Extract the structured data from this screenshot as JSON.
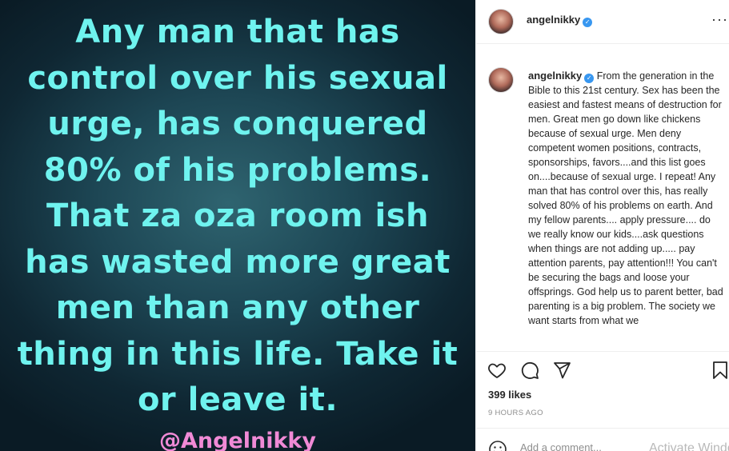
{
  "post": {
    "quote_lines": [
      "Any man that has",
      "control over his sexual",
      "urge, has conquered",
      "80% of his problems.",
      "That za oza room ish",
      "has wasted more great",
      "men than any other",
      "thing in this life. Take it",
      "or leave it."
    ],
    "watermark_handle": "@Angelnikky"
  },
  "header": {
    "username": "angelnikky",
    "verified_glyph": "✓",
    "more_label": "···"
  },
  "caption": {
    "username": "angelnikky",
    "verified_glyph": "✓",
    "text": "From the generation in the Bible to this 21st century. Sex has been the easiest and fastest means of destruction for men. Great men go down like chickens because of sexual urge. Men deny competent women positions, contracts, sponsorships, favors....and this list goes on....because of sexual urge. I repeat! Any man that has control over this, has really solved 80% of his problems on earth. And my fellow parents.... apply pressure.... do we really know our kids....ask questions when things are not adding up..... pay attention parents, pay attention!!! You can't be securing the bags and loose your offsprings. God help us to parent better, bad parenting is a big problem. The society we want starts from what we"
  },
  "actions": {
    "icons": [
      "heart-icon",
      "comment-icon",
      "share-icon",
      "save-icon"
    ],
    "likes": "399 likes",
    "timestamp": "9 HOURS AGO"
  },
  "add_comment": {
    "placeholder": "Add a comment...",
    "emoji_icon": "emoji-icon"
  },
  "overlay": {
    "activate_windows": "Activate Windows"
  },
  "colors": {
    "quote_text": "#6ff3ef",
    "handle_text": "#f08ad6",
    "verified": "#3897f0",
    "muted": "#8e8e8e"
  }
}
